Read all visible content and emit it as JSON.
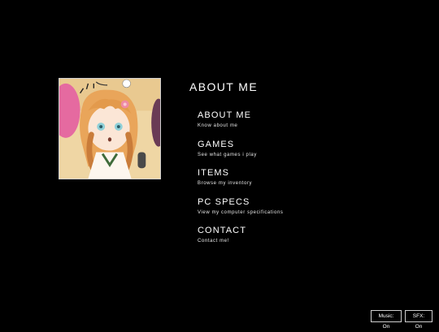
{
  "page": {
    "title": "ABOUT ME"
  },
  "avatar": {
    "icon": "anime-girl-avatar-image"
  },
  "menu": {
    "items": [
      {
        "label": "ABOUT ME",
        "description": "Know about me"
      },
      {
        "label": "GAMES",
        "description": "See what games i play"
      },
      {
        "label": "ITEMS",
        "description": "Browse my inventory"
      },
      {
        "label": "PC SPECS",
        "description": "View my computer specifications"
      },
      {
        "label": "CONTACT",
        "description": "Contact me!"
      }
    ]
  },
  "toggles": {
    "music": "Music: On",
    "sfx": "SFX: On"
  },
  "colors": {
    "background": "#000000",
    "text": "#ffffff",
    "border": "#cfcfcf"
  }
}
